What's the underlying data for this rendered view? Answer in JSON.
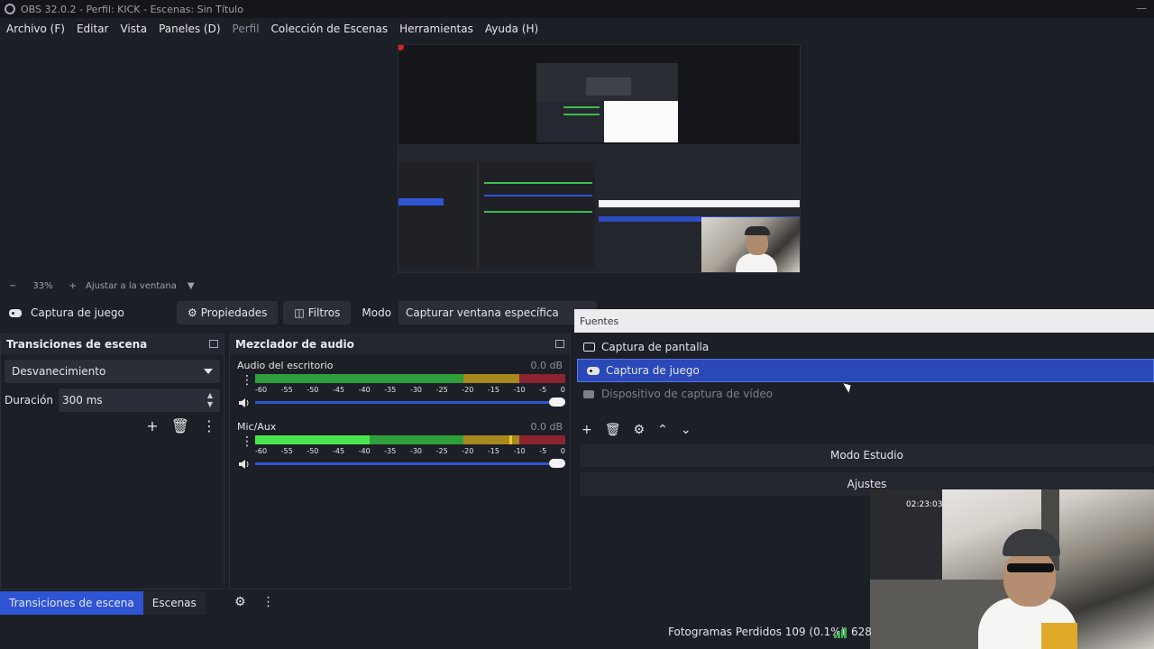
{
  "window": {
    "title": "OBS 32.0.2 - Perfil: KICK - Escenas: Sin Título"
  },
  "menu": [
    {
      "label": "Archivo (F)",
      "disabled": false
    },
    {
      "label": "Editar",
      "disabled": false
    },
    {
      "label": "Vista",
      "disabled": false
    },
    {
      "label": "Paneles (D)",
      "disabled": false
    },
    {
      "label": "Perfil",
      "disabled": true
    },
    {
      "label": "Colección de Escenas",
      "disabled": false
    },
    {
      "label": "Herramientas",
      "disabled": false
    },
    {
      "label": "Ayuda (H)",
      "disabled": false
    }
  ],
  "zoom": {
    "minus": "−",
    "value": "33%",
    "plus": "+",
    "fit_label": "Ajustar a la ventana"
  },
  "source_toolbar": {
    "source_name": "Captura de juego",
    "properties_label": "Propiedades",
    "filters_label": "Filtros",
    "mode_label": "Modo",
    "mode_value": "Capturar ventana específica"
  },
  "transitions": {
    "title": "Transiciones de escena",
    "selected": "Desvanecimiento",
    "duration_label": "Duración",
    "duration_value": "300 ms"
  },
  "mixer": {
    "title": "Mezclador de audio",
    "ticks": [
      "-60",
      "-55",
      "-50",
      "-45",
      "-40",
      "-35",
      "-30",
      "-25",
      "-20",
      "-15",
      "-10",
      "-5",
      "0"
    ],
    "channels": [
      {
        "name": "Audio del escritorio",
        "db": "0.0 dB",
        "level": 0,
        "volume": 1.0
      },
      {
        "name": "Mic/Aux",
        "db": "0.0 dB",
        "level": 0.37,
        "volume": 1.0
      }
    ]
  },
  "sources": {
    "title": "Fuentes",
    "items": [
      {
        "label": "Captura de pantalla",
        "icon": "monitor-icon",
        "selected": false,
        "visible": true
      },
      {
        "label": "Captura de juego",
        "icon": "gamepad-icon",
        "selected": true,
        "visible": true
      },
      {
        "label": "Dispositivo de captura de vídeo",
        "icon": "camera-icon",
        "selected": false,
        "visible": false
      }
    ]
  },
  "controls": {
    "studio_mode": "Modo Estudio",
    "settings": "Ajustes"
  },
  "webcam": {
    "clock": "02:23:03"
  },
  "bottom_tabs": [
    {
      "label": "Transiciones de escena",
      "active": true
    },
    {
      "label": "Escenas",
      "active": false
    }
  ],
  "status": {
    "dropped_frames": "Fotogramas Perdidos 109 (0.1%)",
    "bitrate": "628"
  },
  "colors": {
    "accent": "#2f55d4",
    "selection": "#2b48b8",
    "meter_green": "#2f9f3c",
    "meter_yellow": "#a8891e",
    "meter_red": "#8c2430"
  }
}
